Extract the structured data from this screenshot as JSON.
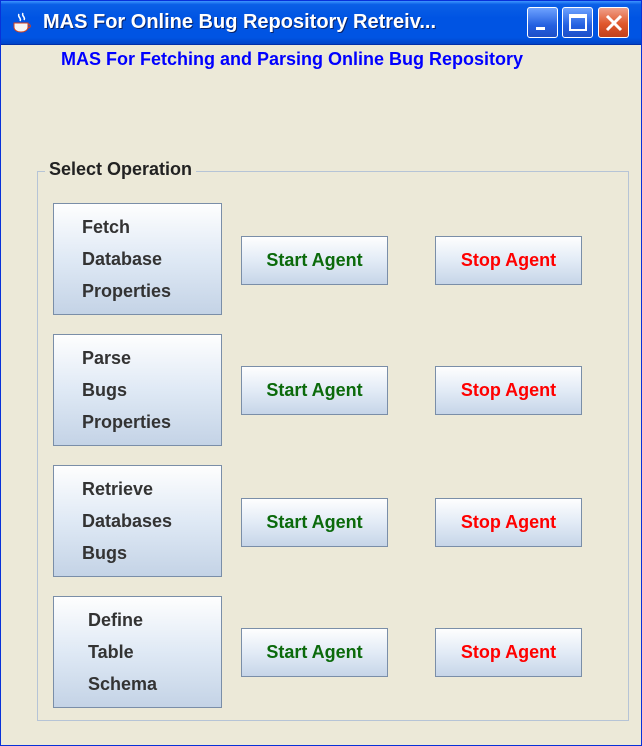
{
  "window": {
    "title": "MAS For Online Bug Repository Retreiv...",
    "controls": {
      "minimize": "minimize-icon",
      "maximize": "maximize-icon",
      "close": "close-icon"
    },
    "app_icon": "java-cup-icon"
  },
  "header": {
    "text": "MAS For Fetching and Parsing Online Bug Repository",
    "color": "#0000ff"
  },
  "group": {
    "label": "Select Operation"
  },
  "operations": [
    {
      "lines": [
        "Fetch",
        "Database",
        "Properties"
      ],
      "start_label": "Start Agent",
      "stop_label": "Stop Agent"
    },
    {
      "lines": [
        "Parse",
        "Bugs",
        "Properties"
      ],
      "start_label": "Start Agent",
      "stop_label": "Stop Agent"
    },
    {
      "lines": [
        "Retrieve",
        "Databases",
        "Bugs"
      ],
      "start_label": "Start Agent",
      "stop_label": "Stop Agent"
    },
    {
      "lines": [
        "Define",
        "Table",
        "Schema"
      ],
      "start_label": "Start Agent",
      "stop_label": "Stop Agent"
    }
  ],
  "colors": {
    "start": "#0b6a0b",
    "stop": "#ff0000",
    "titlebar": "#0054e3"
  }
}
